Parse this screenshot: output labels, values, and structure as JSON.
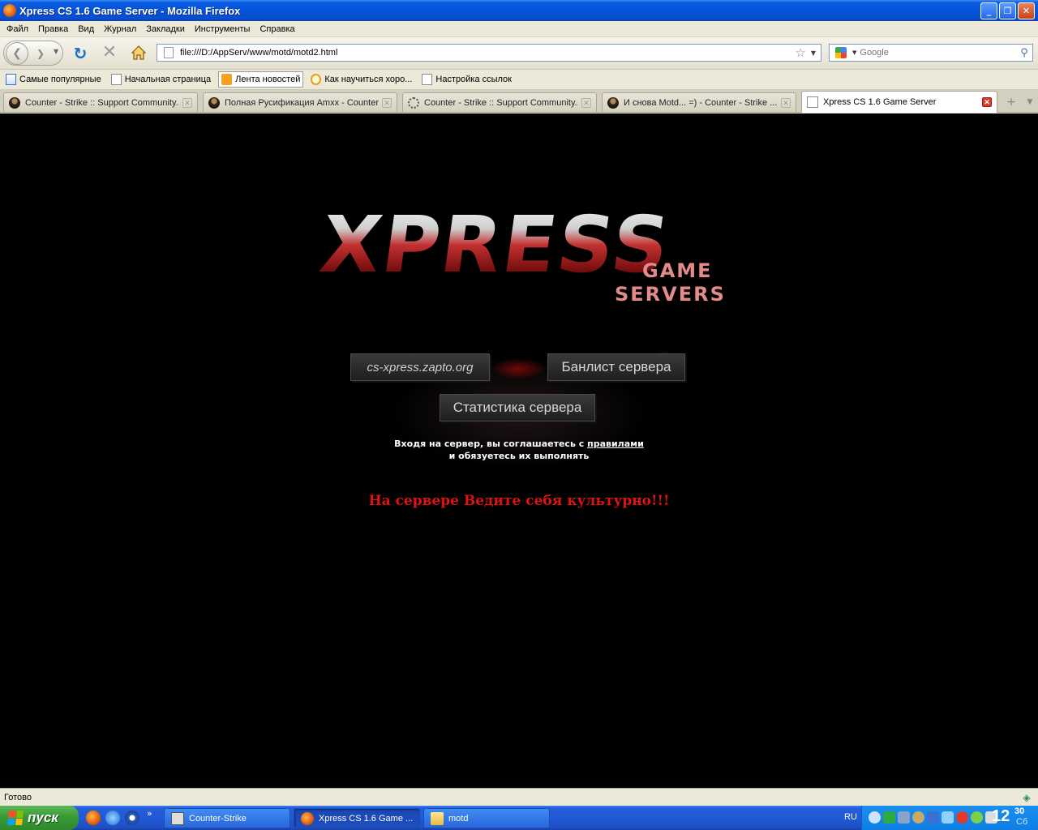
{
  "window": {
    "title": "Xpress CS 1.6 Game Server - Mozilla Firefox",
    "min_label": "_",
    "max_label": "❐",
    "close_label": "✕"
  },
  "menu": {
    "items": [
      {
        "label": "Файл"
      },
      {
        "label": "Правка"
      },
      {
        "label": "Вид"
      },
      {
        "label": "Журнал"
      },
      {
        "label": "Закладки"
      },
      {
        "label": "Инструменты"
      },
      {
        "label": "Справка"
      }
    ]
  },
  "navbar": {
    "url": "file:///D:/AppServ/www/motd/motd2.html",
    "search_placeholder": "Google"
  },
  "bookmarks": [
    {
      "label": "Самые популярные"
    },
    {
      "label": "Начальная страница"
    },
    {
      "label": "Лента новостей"
    },
    {
      "label": "Как научиться хоро..."
    },
    {
      "label": "Настройка ссылок"
    }
  ],
  "tabs": [
    {
      "label": "Counter - Strike :: Support Community..."
    },
    {
      "label": "Полная Русификация Amxx - Counter..."
    },
    {
      "label": "Counter - Strike :: Support Community..."
    },
    {
      "label": "И снова Motd... =) - Counter - Strike ..."
    },
    {
      "label": "Xpress CS 1.6 Game Server"
    }
  ],
  "page": {
    "logo_main": "XPRESS",
    "logo_game": "GAME",
    "logo_servers": "SERVERS",
    "host_button": "cs-xpress.zapto.org",
    "banlist_button": "Банлист сервера",
    "stats_button": "Статистика сервера",
    "agree_prefix": "Входя на сервер, вы соглашаетесь с ",
    "agree_link": "правилами",
    "agree_suffix": "и обязуетесь их выполнять",
    "warning": "На сервере Ведите себя культурно!!!"
  },
  "status": {
    "text": "Готово"
  },
  "taskbar": {
    "start_label": "пуск",
    "quick_more": "»",
    "tasks": [
      {
        "label": "Counter-Strike"
      },
      {
        "label": "Xpress CS 1.6 Game ..."
      },
      {
        "label": "motd"
      }
    ],
    "lang": "RU",
    "clock_hour": "12",
    "clock_min": "30",
    "clock_day": "Сб"
  }
}
